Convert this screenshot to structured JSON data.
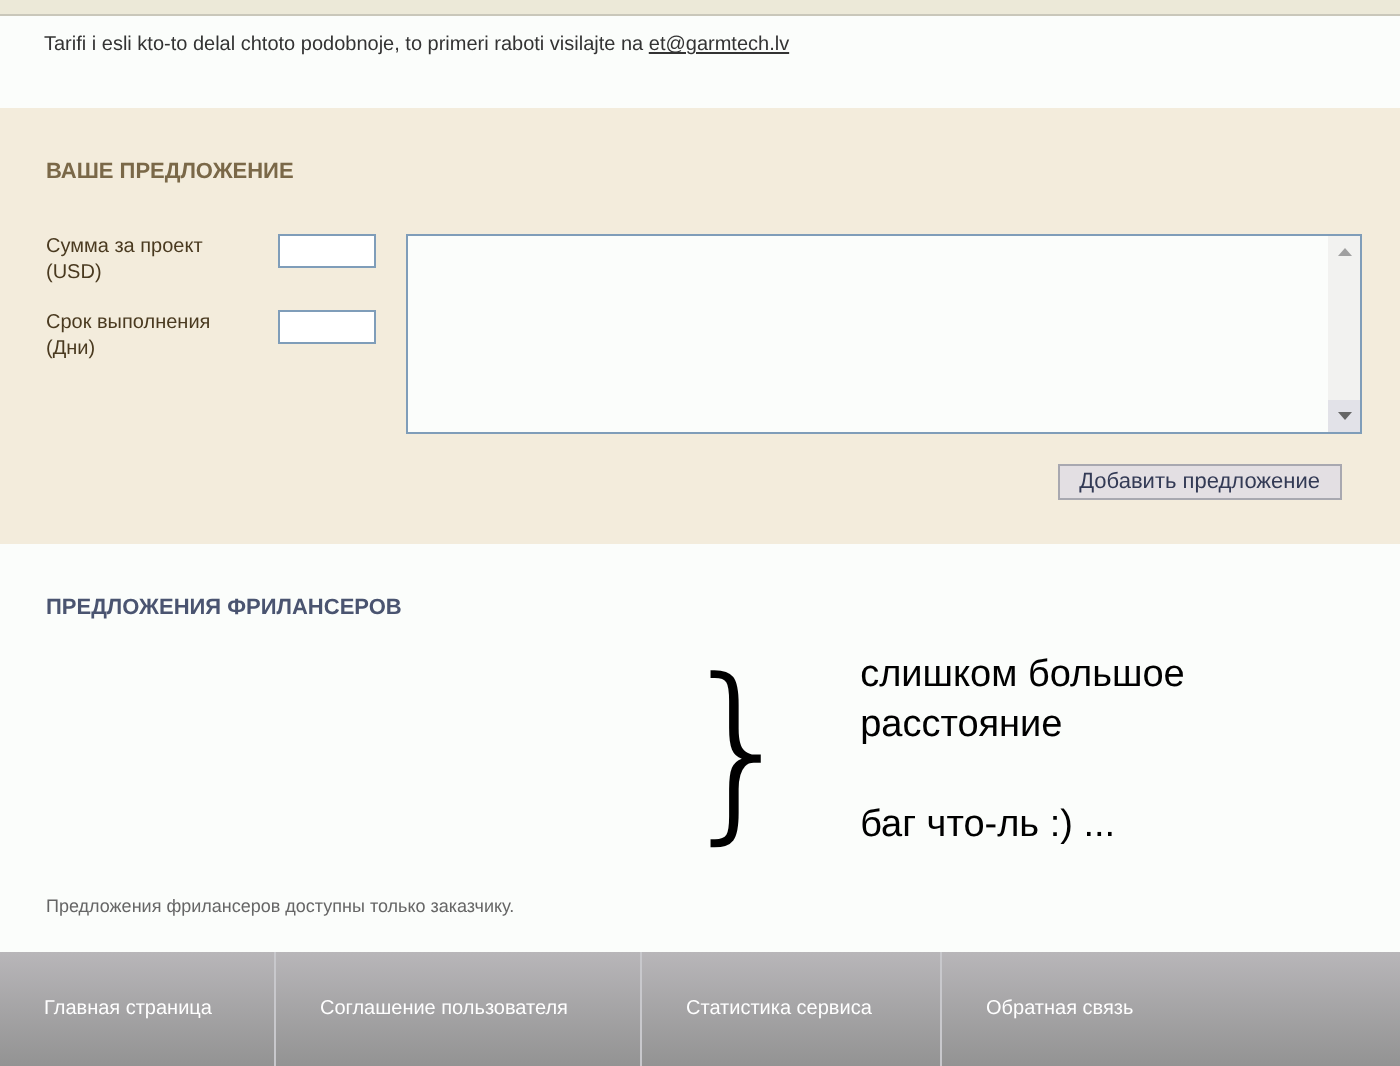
{
  "intro": {
    "text": "Tarifi i esli kto-to delal chtoto podobnoje, to primeri raboti visilajte na",
    "link": "et@garmtech.lv"
  },
  "proposal": {
    "title": "ВАШЕ ПРЕДЛОЖЕНИЕ",
    "fields": [
      {
        "label": "Сумма за проект (USD)"
      },
      {
        "label": "Срок выполнения (Дни)"
      }
    ],
    "button": "Добавить предложение"
  },
  "freelancers": {
    "title": "ПРЕДЛОЖЕНИЯ ФРИЛАНСЕРОВ",
    "note": "Предложения фрилансеров доступны только заказчику.",
    "annotation": {
      "brace": "}",
      "lines": [
        "слишком большое",
        "расстояние",
        "баг что-ль :) ..."
      ]
    }
  },
  "footer": [
    "Главная страница",
    "Соглашение пользователя",
    "Статистика сервиса",
    "Обратная связь"
  ]
}
